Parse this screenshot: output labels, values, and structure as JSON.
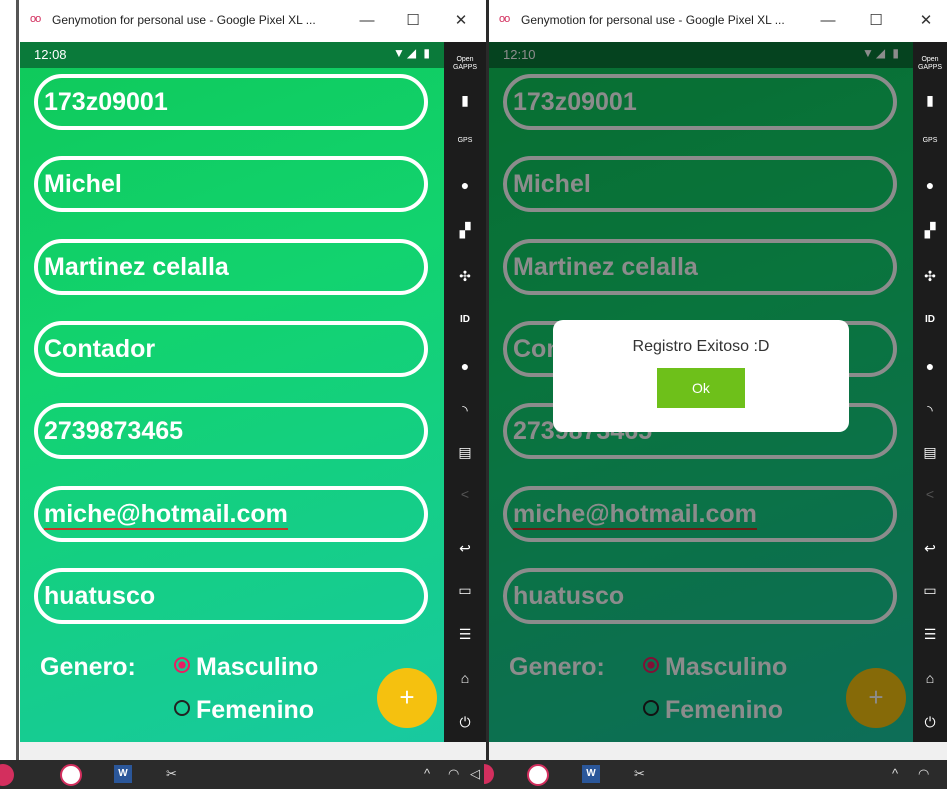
{
  "window": {
    "title": "Genymotion for personal use - Google Pixel XL ...",
    "logo": "oo",
    "minimize": "—",
    "maximize": "☐",
    "close": "✕"
  },
  "left_device": {
    "status_time": "12:08",
    "status_icons": "▼◢ ▮"
  },
  "right_device": {
    "status_time": "12:10",
    "status_icons": "▼◢ ▮"
  },
  "form": {
    "control_number": "173z09001",
    "first_name": "Michel",
    "last_name": "Martinez celalla",
    "occupation": "Contador",
    "phone": "2739873465",
    "email": "miche@hotmail.com",
    "city": "huatusco",
    "gender_label": "Genero:",
    "gender_options": [
      "Masculino",
      "Femenino"
    ],
    "gender_selected": "Masculino",
    "fab": "+"
  },
  "dialog": {
    "message": "Registro Exitoso :D",
    "ok": "Ok"
  },
  "toolbar": {
    "open_gapps": "Open GAPPS",
    "gps": "GPS",
    "id": "ID",
    "battery_icon": "battery-icon",
    "gps_icon": "gps-icon",
    "camera_icon": "webcam-icon",
    "clapper_icon": "clapperboard-icon",
    "move_icon": "move-icon",
    "id_icon": "id-icon",
    "record_icon": "record-icon",
    "rss_icon": "rss-icon",
    "message_icon": "message-icon",
    "share_icon": "share-icon",
    "back_icon": "back-icon",
    "recent_icon": "recent-apps-icon",
    "menu_icon": "menu-icon",
    "home_icon": "home-icon",
    "power_icon": "power-icon"
  },
  "colors": {
    "screen_green": "#12d36f",
    "fab_yellow": "#f5c10f",
    "ok_green": "#6ec01a",
    "radio_pink": "#e91e63"
  }
}
